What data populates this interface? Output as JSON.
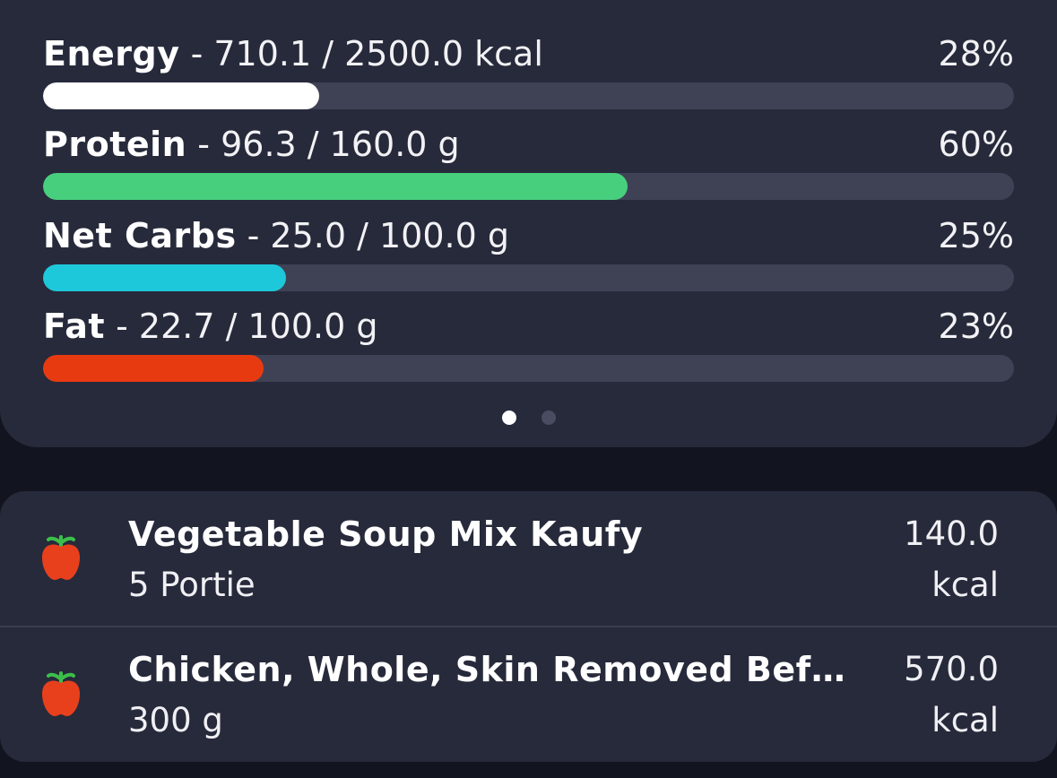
{
  "nutrients": [
    {
      "name": "Energy",
      "amount": " - 710.1 / 2500.0 kcal",
      "percent_label": "28%",
      "fraction": 0.284,
      "color": "#ffffff"
    },
    {
      "name": "Protein",
      "amount": " - 96.3 / 160.0 g",
      "percent_label": "60%",
      "fraction": 0.602,
      "color": "#48cf7e"
    },
    {
      "name": "Net Carbs",
      "amount": " - 25.0 / 100.0 g",
      "percent_label": "25%",
      "fraction": 0.25,
      "color": "#1ec8db"
    },
    {
      "name": "Fat",
      "amount": " - 22.7 / 100.0 g",
      "percent_label": "23%",
      "fraction": 0.227,
      "color": "#e83a10"
    }
  ],
  "pager": {
    "pages": 2,
    "active": 0
  },
  "foods": [
    {
      "name": "Vegetable Soup Mix Kaufy",
      "portion": "5 Portie",
      "kcal_value": "140.0",
      "kcal_unit": "kcal",
      "icon": "apple-icon"
    },
    {
      "name": "Chicken, Whole, Skin Removed Befor…",
      "portion": "300 g",
      "kcal_value": "570.0",
      "kcal_unit": "kcal",
      "icon": "apple-icon"
    }
  ],
  "colors": {
    "background": "#12141f",
    "card": "#272a3b",
    "track": "#3f4255",
    "apple_red": "#e8401c",
    "apple_leaf": "#3cbf4a"
  }
}
